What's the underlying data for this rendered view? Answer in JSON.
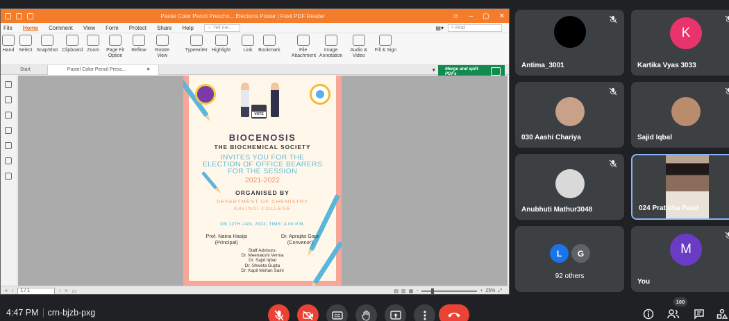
{
  "pdf_app": {
    "title": "Pastel Color Pencil Prescho... Elections Poster | Foxit PDF Reader",
    "menu": [
      "File",
      "Home",
      "Comment",
      "View",
      "Form",
      "Protect",
      "Share",
      "Help"
    ],
    "active_menu": "Home",
    "tell_me": "Tell me...",
    "find_placeholder": "Find",
    "ribbon": [
      {
        "label": "Hand",
        "name": "hand-tool"
      },
      {
        "label": "Select",
        "name": "select-tool"
      },
      {
        "label": "SnapShot",
        "name": "snapshot-tool"
      },
      {
        "label": "Clipboard",
        "name": "clipboard-tool"
      },
      {
        "label": "Zoom",
        "name": "zoom-tool"
      },
      {
        "label": "Page Fit Option",
        "name": "page-fit-tool"
      },
      {
        "label": "Reflow",
        "name": "reflow-tool"
      },
      {
        "label": "Rotate View",
        "name": "rotate-tool"
      },
      {
        "label": "Typewriter",
        "name": "typewriter-tool"
      },
      {
        "label": "Highlight",
        "name": "highlight-tool"
      },
      {
        "label": "Link",
        "name": "link-tool"
      },
      {
        "label": "Bookmark",
        "name": "bookmark-tool"
      },
      {
        "label": "File Attachment",
        "name": "file-attachment-tool"
      },
      {
        "label": "Image Annotation",
        "name": "image-annotation-tool"
      },
      {
        "label": "Audio & Video",
        "name": "audio-video-tool"
      },
      {
        "label": "Fill & Sign",
        "name": "fill-sign-tool"
      }
    ],
    "tabs": {
      "start": "Start",
      "doc": "Pastel Color Pencil Presc..."
    },
    "promo": "Merge and split PDFs",
    "page_indicator": "1 / 1",
    "zoom_level": "25%"
  },
  "poster": {
    "ballot": "VOTE",
    "name": "BIOCENOSIS",
    "society": "THE BIOCHEMICAL SOCIETY",
    "invite": [
      "INVITES YOU FOR THE",
      "ELECTION OF OFFICE BEARERS",
      "FOR THE SESSION"
    ],
    "session": "2021-2022",
    "organised_by": "ORGANISED BY",
    "dept": [
      "DEPARTMENT OF CHEMISTRY",
      "KALINDI COLLEGE"
    ],
    "date": "ON 12TH JAN, 2022, TIME: 4.00 P.M.",
    "left_person": {
      "name": "Prof. Naina Hasija",
      "role": "(Principal)"
    },
    "right_person": {
      "name": "Dr. Aprajita Gaur",
      "role": "(Convenor)"
    },
    "advisors_title": "Staff Advisors:",
    "advisors": [
      "Dr. Meenakshi Verma",
      "Dr. Sajid Iqbal",
      "Dr. Shweta Gupta",
      "Dr. Kapil Mohan Saini"
    ]
  },
  "participants": [
    {
      "name": "Antima_3001",
      "avatar": "",
      "color": "#000000",
      "muted": true
    },
    {
      "name": "Kartika Vyas 3033",
      "avatar": "K",
      "color": "#e8336d",
      "muted": true
    },
    {
      "name": "030 Aashi Chariya",
      "avatar": "",
      "color": "#c9a188",
      "muted": true
    },
    {
      "name": "Sajid Iqbal",
      "avatar": "",
      "color": "#b98c6d",
      "muted": true
    },
    {
      "name": "Anubhuti Mathur3048",
      "avatar": "",
      "color": "#d9d9d9",
      "muted": true
    },
    {
      "name": "024 Pratibha Patel",
      "avatar": "",
      "color": "#8a6d5a",
      "muted": false
    },
    {
      "name": "92 others",
      "avatar": "",
      "color": "#3c4043",
      "muted": false
    },
    {
      "name": "You",
      "avatar": "M",
      "color": "#6a3bc4",
      "muted": true
    }
  ],
  "others_avatars": [
    "L",
    "G"
  ],
  "meeting": {
    "time": "4:47 PM",
    "code": "crn-bjzb-pxg",
    "people_count": "100"
  }
}
